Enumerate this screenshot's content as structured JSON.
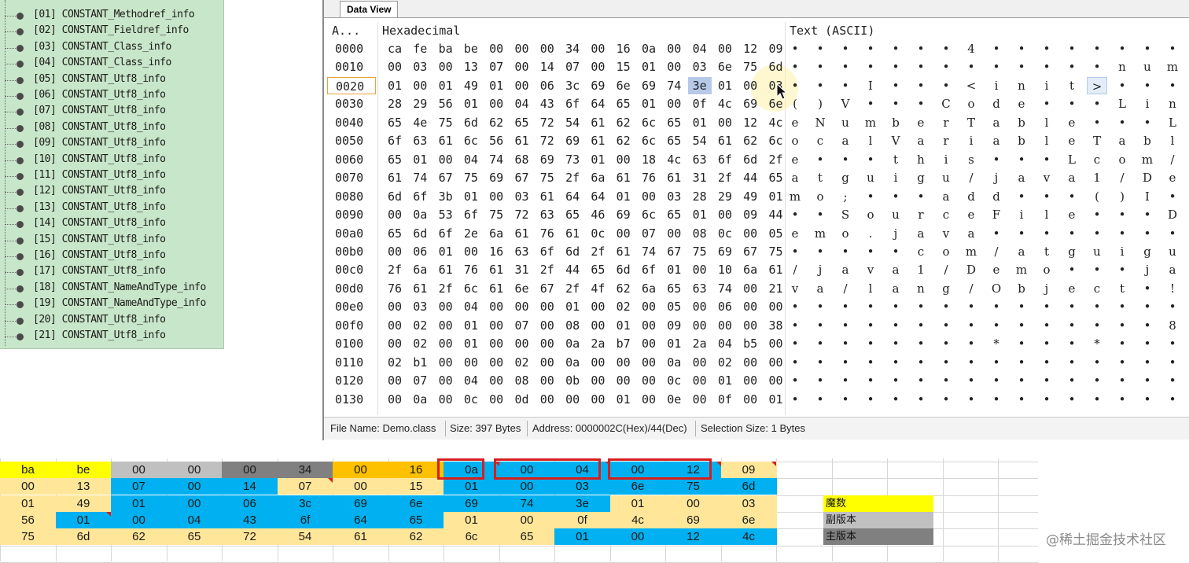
{
  "tree": {
    "items": [
      "[01] CONSTANT_Methodref_info",
      "[02] CONSTANT_Fieldref_info",
      "[03] CONSTANT_Class_info",
      "[04] CONSTANT_Class_info",
      "[05] CONSTANT_Utf8_info",
      "[06] CONSTANT_Utf8_info",
      "[07] CONSTANT_Utf8_info",
      "[08] CONSTANT_Utf8_info",
      "[09] CONSTANT_Utf8_info",
      "[10] CONSTANT_Utf8_info",
      "[11] CONSTANT_Utf8_info",
      "[12] CONSTANT_Utf8_info",
      "[13] CONSTANT_Utf8_info",
      "[14] CONSTANT_Utf8_info",
      "[15] CONSTANT_Utf8_info",
      "[16] CONSTANT_Utf8_info",
      "[17] CONSTANT_Utf8_info",
      "[18] CONSTANT_NameAndType_info",
      "[19] CONSTANT_NameAndType_info",
      "[20] CONSTANT_Utf8_info",
      "[21] CONSTANT_Utf8_info"
    ]
  },
  "data_view": {
    "tab_label": "Data View",
    "col_address": "A...",
    "col_hex": "Hexadecimal",
    "col_text": "Text (ASCII)",
    "rows": [
      {
        "addr": "0000",
        "hex": [
          "ca",
          "fe",
          "ba",
          "be",
          "00",
          "00",
          "00",
          "34",
          "00",
          "16",
          "0a",
          "00",
          "04",
          "00",
          "12",
          "09"
        ],
        "ascii": [
          "•",
          "•",
          "•",
          "•",
          "•",
          "•",
          "•",
          "4",
          "•",
          "•",
          "•",
          "•",
          "•",
          "•",
          "•",
          "•"
        ]
      },
      {
        "addr": "0010",
        "hex": [
          "00",
          "03",
          "00",
          "13",
          "07",
          "00",
          "14",
          "07",
          "00",
          "15",
          "01",
          "00",
          "03",
          "6e",
          "75",
          "6d"
        ],
        "ascii": [
          "•",
          "•",
          "•",
          "•",
          "•",
          "•",
          "•",
          "•",
          "•",
          "•",
          "•",
          "•",
          "•",
          "n",
          "u",
          "m"
        ]
      },
      {
        "addr": "0020",
        "hex": [
          "01",
          "00",
          "01",
          "49",
          "01",
          "00",
          "06",
          "3c",
          "69",
          "6e",
          "69",
          "74",
          "3e",
          "01",
          "00",
          "03"
        ],
        "ascii": [
          "•",
          "•",
          "•",
          "I",
          "•",
          "•",
          "•",
          "<",
          "i",
          "n",
          "i",
          "t",
          ">",
          "•",
          "•",
          "•"
        ]
      },
      {
        "addr": "0030",
        "hex": [
          "28",
          "29",
          "56",
          "01",
          "00",
          "04",
          "43",
          "6f",
          "64",
          "65",
          "01",
          "00",
          "0f",
          "4c",
          "69",
          "6e"
        ],
        "ascii": [
          "(",
          ")",
          "V",
          "•",
          "•",
          "•",
          "C",
          "o",
          "d",
          "e",
          "•",
          "•",
          "•",
          "L",
          "i",
          "n"
        ]
      },
      {
        "addr": "0040",
        "hex": [
          "65",
          "4e",
          "75",
          "6d",
          "62",
          "65",
          "72",
          "54",
          "61",
          "62",
          "6c",
          "65",
          "01",
          "00",
          "12",
          "4c"
        ],
        "ascii": [
          "e",
          "N",
          "u",
          "m",
          "b",
          "e",
          "r",
          "T",
          "a",
          "b",
          "l",
          "e",
          "•",
          "•",
          "•",
          "L"
        ]
      },
      {
        "addr": "0050",
        "hex": [
          "6f",
          "63",
          "61",
          "6c",
          "56",
          "61",
          "72",
          "69",
          "61",
          "62",
          "6c",
          "65",
          "54",
          "61",
          "62",
          "6c"
        ],
        "ascii": [
          "o",
          "c",
          "a",
          "l",
          "V",
          "a",
          "r",
          "i",
          "a",
          "b",
          "l",
          "e",
          "T",
          "a",
          "b",
          "l"
        ]
      },
      {
        "addr": "0060",
        "hex": [
          "65",
          "01",
          "00",
          "04",
          "74",
          "68",
          "69",
          "73",
          "01",
          "00",
          "18",
          "4c",
          "63",
          "6f",
          "6d",
          "2f"
        ],
        "ascii": [
          "e",
          "•",
          "•",
          "•",
          "t",
          "h",
          "i",
          "s",
          "•",
          "•",
          "•",
          "L",
          "c",
          "o",
          "m",
          "/"
        ]
      },
      {
        "addr": "0070",
        "hex": [
          "61",
          "74",
          "67",
          "75",
          "69",
          "67",
          "75",
          "2f",
          "6a",
          "61",
          "76",
          "61",
          "31",
          "2f",
          "44",
          "65"
        ],
        "ascii": [
          "a",
          "t",
          "g",
          "u",
          "i",
          "g",
          "u",
          "/",
          "j",
          "a",
          "v",
          "a",
          "1",
          "/",
          "D",
          "e"
        ]
      },
      {
        "addr": "0080",
        "hex": [
          "6d",
          "6f",
          "3b",
          "01",
          "00",
          "03",
          "61",
          "64",
          "64",
          "01",
          "00",
          "03",
          "28",
          "29",
          "49",
          "01"
        ],
        "ascii": [
          "m",
          "o",
          ";",
          "•",
          "•",
          "•",
          "a",
          "d",
          "d",
          "•",
          "•",
          "•",
          "(",
          ")",
          "I",
          "•"
        ]
      },
      {
        "addr": "0090",
        "hex": [
          "00",
          "0a",
          "53",
          "6f",
          "75",
          "72",
          "63",
          "65",
          "46",
          "69",
          "6c",
          "65",
          "01",
          "00",
          "09",
          "44"
        ],
        "ascii": [
          "•",
          "•",
          "S",
          "o",
          "u",
          "r",
          "c",
          "e",
          "F",
          "i",
          "l",
          "e",
          "•",
          "•",
          "•",
          "D"
        ]
      },
      {
        "addr": "00a0",
        "hex": [
          "65",
          "6d",
          "6f",
          "2e",
          "6a",
          "61",
          "76",
          "61",
          "0c",
          "00",
          "07",
          "00",
          "08",
          "0c",
          "00",
          "05"
        ],
        "ascii": [
          "e",
          "m",
          "o",
          ".",
          "j",
          "a",
          "v",
          "a",
          "•",
          "•",
          "•",
          "•",
          "•",
          "•",
          "•",
          "•"
        ]
      },
      {
        "addr": "00b0",
        "hex": [
          "00",
          "06",
          "01",
          "00",
          "16",
          "63",
          "6f",
          "6d",
          "2f",
          "61",
          "74",
          "67",
          "75",
          "69",
          "67",
          "75"
        ],
        "ascii": [
          "•",
          "•",
          "•",
          "•",
          "•",
          "c",
          "o",
          "m",
          "/",
          "a",
          "t",
          "g",
          "u",
          "i",
          "g",
          "u"
        ]
      },
      {
        "addr": "00c0",
        "hex": [
          "2f",
          "6a",
          "61",
          "76",
          "61",
          "31",
          "2f",
          "44",
          "65",
          "6d",
          "6f",
          "01",
          "00",
          "10",
          "6a",
          "61"
        ],
        "ascii": [
          "/",
          "j",
          "a",
          "v",
          "a",
          "1",
          "/",
          "D",
          "e",
          "m",
          "o",
          "•",
          "•",
          "•",
          "j",
          "a"
        ]
      },
      {
        "addr": "00d0",
        "hex": [
          "76",
          "61",
          "2f",
          "6c",
          "61",
          "6e",
          "67",
          "2f",
          "4f",
          "62",
          "6a",
          "65",
          "63",
          "74",
          "00",
          "21"
        ],
        "ascii": [
          "v",
          "a",
          "/",
          "l",
          "a",
          "n",
          "g",
          "/",
          "O",
          "b",
          "j",
          "e",
          "c",
          "t",
          "•",
          "!"
        ]
      },
      {
        "addr": "00e0",
        "hex": [
          "00",
          "03",
          "00",
          "04",
          "00",
          "00",
          "00",
          "01",
          "00",
          "02",
          "00",
          "05",
          "00",
          "06",
          "00",
          "00"
        ],
        "ascii": [
          "•",
          "•",
          "•",
          "•",
          "•",
          "•",
          "•",
          "•",
          "•",
          "•",
          "•",
          "•",
          "•",
          "•",
          "•",
          "•"
        ]
      },
      {
        "addr": "00f0",
        "hex": [
          "00",
          "02",
          "00",
          "01",
          "00",
          "07",
          "00",
          "08",
          "00",
          "01",
          "00",
          "09",
          "00",
          "00",
          "00",
          "38"
        ],
        "ascii": [
          "•",
          "•",
          "•",
          "•",
          "•",
          "•",
          "•",
          "•",
          "•",
          "•",
          "•",
          "•",
          "•",
          "•",
          "•",
          "8"
        ]
      },
      {
        "addr": "0100",
        "hex": [
          "00",
          "02",
          "00",
          "01",
          "00",
          "00",
          "00",
          "0a",
          "2a",
          "b7",
          "00",
          "01",
          "2a",
          "04",
          "b5",
          "00"
        ],
        "ascii": [
          "•",
          "•",
          "•",
          "•",
          "•",
          "•",
          "•",
          "•",
          "*",
          "•",
          "•",
          "•",
          "*",
          "•",
          "•",
          "•"
        ]
      },
      {
        "addr": "0110",
        "hex": [
          "02",
          "b1",
          "00",
          "00",
          "00",
          "02",
          "00",
          "0a",
          "00",
          "00",
          "00",
          "0a",
          "00",
          "02",
          "00",
          "00"
        ],
        "ascii": [
          "•",
          "•",
          "•",
          "•",
          "•",
          "•",
          "•",
          "•",
          "•",
          "•",
          "•",
          "•",
          "•",
          "•",
          "•",
          "•"
        ]
      },
      {
        "addr": "0120",
        "hex": [
          "00",
          "07",
          "00",
          "04",
          "00",
          "08",
          "00",
          "0b",
          "00",
          "00",
          "00",
          "0c",
          "00",
          "01",
          "00",
          "00"
        ],
        "ascii": [
          "•",
          "•",
          "•",
          "•",
          "•",
          "•",
          "•",
          "•",
          "•",
          "•",
          "•",
          "•",
          "•",
          "•",
          "•",
          "•"
        ]
      },
      {
        "addr": "0130",
        "hex": [
          "00",
          "0a",
          "00",
          "0c",
          "00",
          "0d",
          "00",
          "00",
          "00",
          "01",
          "00",
          "0e",
          "00",
          "0f",
          "00",
          "01"
        ],
        "ascii": [
          "•",
          "•",
          "•",
          "•",
          "•",
          "•",
          "•",
          "•",
          "•",
          "•",
          "•",
          "•",
          "•",
          "•",
          "•",
          "•"
        ]
      }
    ],
    "status": {
      "file_name": "File Name: Demo.class",
      "size": "Size: 397 Bytes",
      "address": "Address: 0000002C(Hex)/44(Dec)",
      "selection": "Selection Size: 1 Bytes"
    }
  },
  "sheet": {
    "rows": [
      [
        {
          "v": "ba",
          "c": "#ffff00"
        },
        {
          "v": "be",
          "c": "#ffff00"
        },
        {
          "v": "00",
          "c": "#c0c0c0"
        },
        {
          "v": "00",
          "c": "#c0c0c0"
        },
        {
          "v": "00",
          "c": "#808080"
        },
        {
          "v": "34",
          "c": "#808080"
        },
        {
          "v": "00",
          "c": "#ffc000"
        },
        {
          "v": "16",
          "c": "#ffc000"
        },
        {
          "v": "0a",
          "c": "#00b0f0"
        },
        {
          "v": "00",
          "c": "#00b0f0"
        },
        {
          "v": "04",
          "c": "#00b0f0"
        },
        {
          "v": "00",
          "c": "#00b0f0"
        },
        {
          "v": "12",
          "c": "#00b0f0"
        },
        {
          "v": "09",
          "c": "#ffe699"
        }
      ],
      [
        {
          "v": "00",
          "c": "#ffe699"
        },
        {
          "v": "13",
          "c": "#ffe699"
        },
        {
          "v": "07",
          "c": "#00b0f0"
        },
        {
          "v": "00",
          "c": "#00b0f0"
        },
        {
          "v": "14",
          "c": "#00b0f0"
        },
        {
          "v": "07",
          "c": "#ffe699"
        },
        {
          "v": "00",
          "c": "#ffe699"
        },
        {
          "v": "15",
          "c": "#ffe699"
        },
        {
          "v": "01",
          "c": "#00b0f0"
        },
        {
          "v": "00",
          "c": "#00b0f0"
        },
        {
          "v": "03",
          "c": "#00b0f0"
        },
        {
          "v": "6e",
          "c": "#00b0f0"
        },
        {
          "v": "75",
          "c": "#00b0f0"
        },
        {
          "v": "6d",
          "c": "#00b0f0"
        }
      ],
      [
        {
          "v": "01",
          "c": "#ffe699"
        },
        {
          "v": "49",
          "c": "#ffe699"
        },
        {
          "v": "01",
          "c": "#00b0f0"
        },
        {
          "v": "00",
          "c": "#00b0f0"
        },
        {
          "v": "06",
          "c": "#00b0f0"
        },
        {
          "v": "3c",
          "c": "#00b0f0"
        },
        {
          "v": "69",
          "c": "#00b0f0"
        },
        {
          "v": "6e",
          "c": "#00b0f0"
        },
        {
          "v": "69",
          "c": "#00b0f0"
        },
        {
          "v": "74",
          "c": "#00b0f0"
        },
        {
          "v": "3e",
          "c": "#00b0f0"
        },
        {
          "v": "01",
          "c": "#ffe699"
        },
        {
          "v": "00",
          "c": "#ffe699"
        },
        {
          "v": "03",
          "c": "#ffe699"
        }
      ],
      [
        {
          "v": "56",
          "c": "#ffe699"
        },
        {
          "v": "01",
          "c": "#00b0f0"
        },
        {
          "v": "00",
          "c": "#00b0f0"
        },
        {
          "v": "04",
          "c": "#00b0f0"
        },
        {
          "v": "43",
          "c": "#00b0f0"
        },
        {
          "v": "6f",
          "c": "#00b0f0"
        },
        {
          "v": "64",
          "c": "#00b0f0"
        },
        {
          "v": "65",
          "c": "#00b0f0"
        },
        {
          "v": "01",
          "c": "#ffe699"
        },
        {
          "v": "00",
          "c": "#ffe699"
        },
        {
          "v": "0f",
          "c": "#ffe699"
        },
        {
          "v": "4c",
          "c": "#ffe699"
        },
        {
          "v": "69",
          "c": "#ffe699"
        },
        {
          "v": "6e",
          "c": "#ffe699"
        }
      ],
      [
        {
          "v": "75",
          "c": "#ffe699"
        },
        {
          "v": "6d",
          "c": "#ffe699"
        },
        {
          "v": "62",
          "c": "#ffe699"
        },
        {
          "v": "65",
          "c": "#ffe699"
        },
        {
          "v": "72",
          "c": "#ffe699"
        },
        {
          "v": "54",
          "c": "#ffe699"
        },
        {
          "v": "61",
          "c": "#ffe699"
        },
        {
          "v": "62",
          "c": "#ffe699"
        },
        {
          "v": "6c",
          "c": "#ffe699"
        },
        {
          "v": "65",
          "c": "#ffe699"
        },
        {
          "v": "01",
          "c": "#00b0f0"
        },
        {
          "v": "00",
          "c": "#00b0f0"
        },
        {
          "v": "12",
          "c": "#00b0f0"
        },
        {
          "v": "4c",
          "c": "#00b0f0"
        }
      ]
    ],
    "legend": [
      {
        "label": "魔数",
        "color": "#ffff00"
      },
      {
        "label": "副版本",
        "color": "#c0c0c0"
      },
      {
        "label": "主版本",
        "color": "#808080"
      }
    ]
  },
  "watermark": "@稀土掘金技术社区"
}
